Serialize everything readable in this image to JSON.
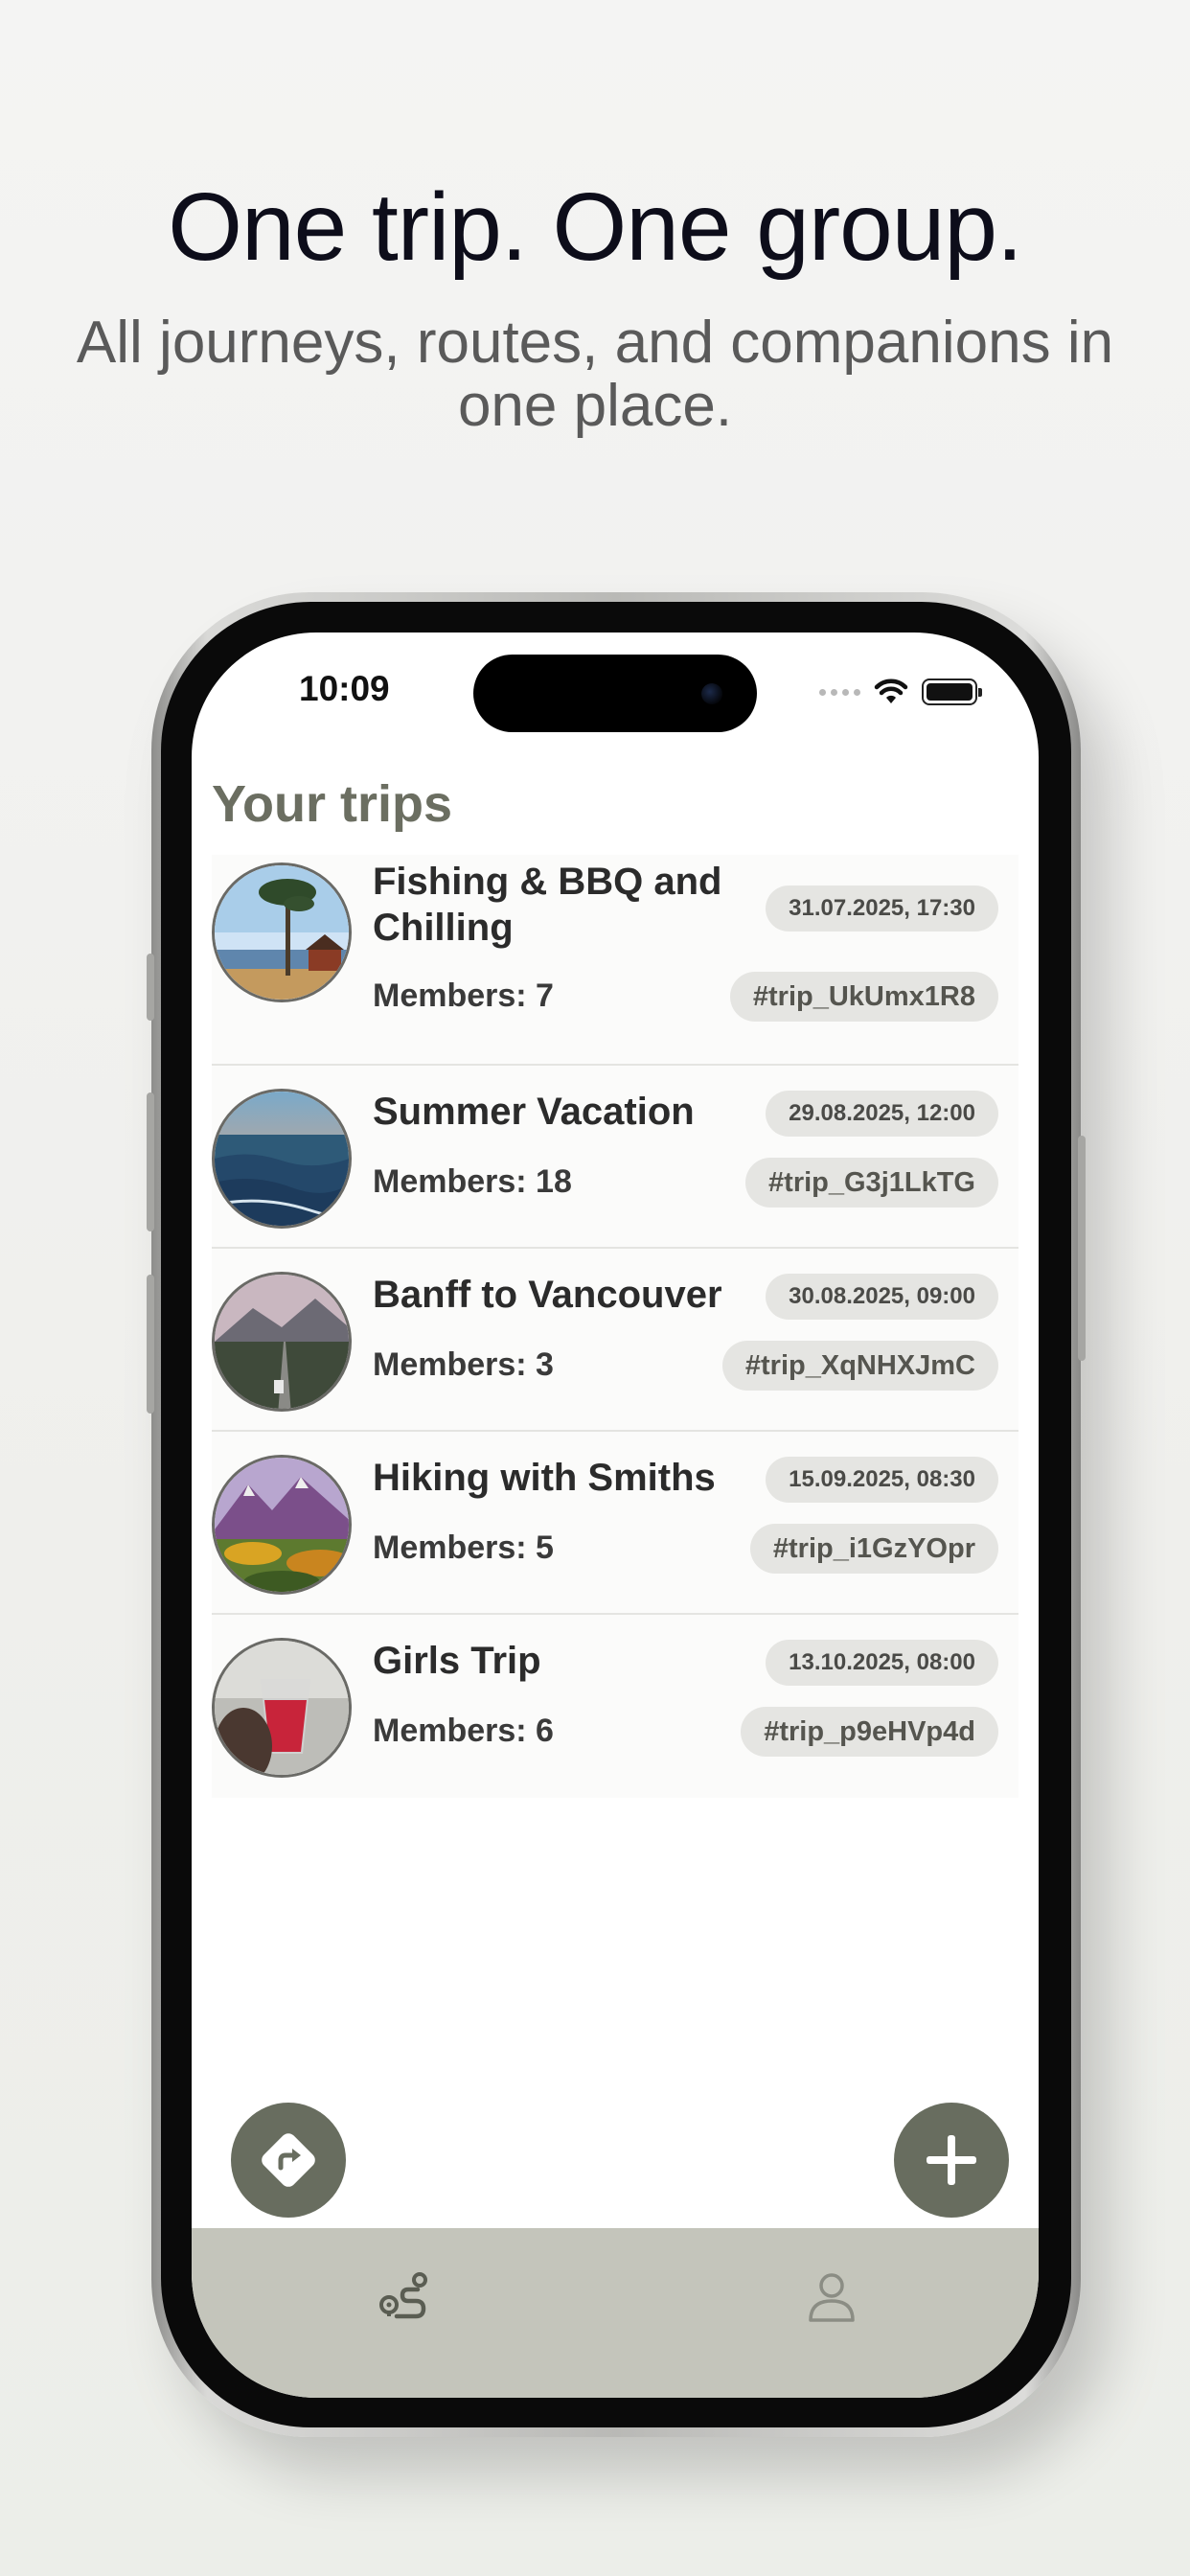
{
  "headline": "One trip. One group.",
  "subheadline": "All journeys, routes, and companions in one place.",
  "status_bar": {
    "time": "10:09"
  },
  "page_title": "Your trips",
  "trips": [
    {
      "name": "Fishing & BBQ and Chilling",
      "members": "Members: 7",
      "date": "31.07.2025, 17:30",
      "code": "#trip_UkUmx1R8",
      "image": "lake-tree-cabin"
    },
    {
      "name": "Summer Vacation",
      "members": "Members: 18",
      "date": "29.08.2025, 12:00",
      "code": "#trip_G3j1LkTG",
      "image": "ocean-sunset"
    },
    {
      "name": "Banff to Vancouver",
      "members": "Members: 3",
      "date": "30.08.2025, 09:00",
      "code": "#trip_XqNHXJmC",
      "image": "mountain-road"
    },
    {
      "name": "Hiking with Smiths",
      "members": "Members: 5",
      "date": "15.09.2025, 08:30",
      "code": "#trip_i1GzYOpr",
      "image": "autumn-mountains"
    },
    {
      "name": "Girls Trip",
      "members": "Members: 6",
      "date": "13.10.2025, 08:00",
      "code": "#trip_p9eHVp4d",
      "image": "red-drink"
    }
  ],
  "actions": {
    "left_fab_icon": "directions-icon",
    "right_fab_icon": "plus-icon"
  },
  "tabs": [
    {
      "icon": "route-icon",
      "active": true
    },
    {
      "icon": "profile-icon",
      "active": false
    }
  ],
  "colors": {
    "accent": "#686d5f",
    "tabbar": "#c4c5bb",
    "title": "#6b6e61"
  }
}
